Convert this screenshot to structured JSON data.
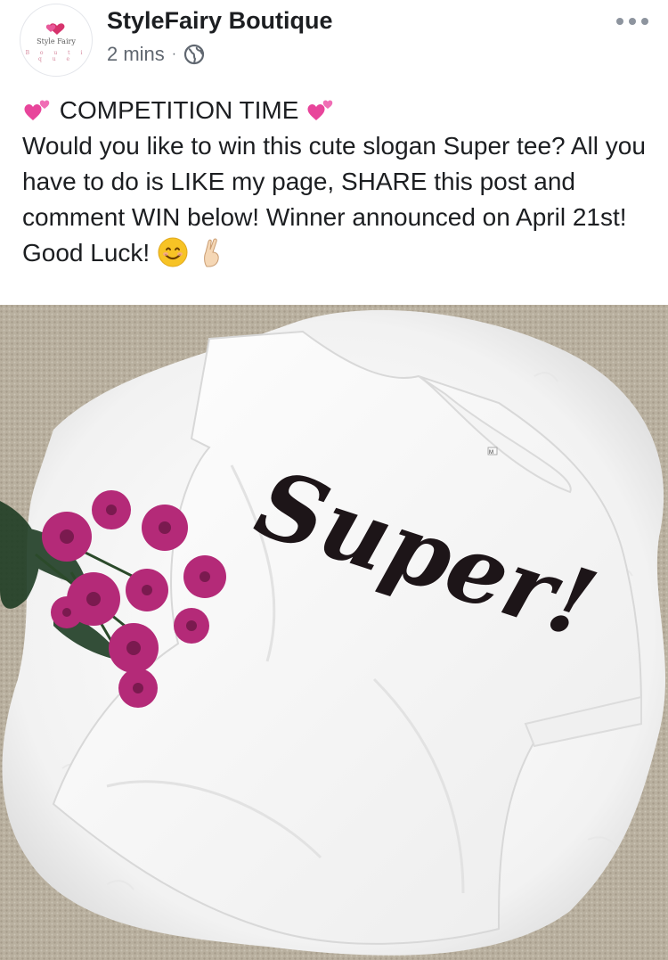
{
  "post": {
    "page_name": "StyleFairy Boutique",
    "timestamp": "2 mins",
    "separator": "·",
    "privacy_icon": "globe-icon",
    "more_icon": "more-options-icon",
    "avatar": {
      "logo_text": "Style Fairy",
      "logo_subtext": "B o u t i q u e"
    },
    "caption": {
      "line1": "COMPETITION TIME",
      "body": "Would you like to win this cute slogan Super tee? All you have to do is LIKE my page, SHARE this post and comment WIN below! Winner announced on April 21st! Good Luck!",
      "emojis": [
        "two-hearts",
        "smiling-face",
        "crossed-fingers"
      ]
    },
    "photo": {
      "tshirt_text": "Super!",
      "tag_text": "M"
    }
  },
  "colors": {
    "text": "#1c1e21",
    "secondary": "#606770",
    "heart_pink": "#e8459b",
    "flower": "#b42a78",
    "carpet": "#b7ad9d"
  }
}
